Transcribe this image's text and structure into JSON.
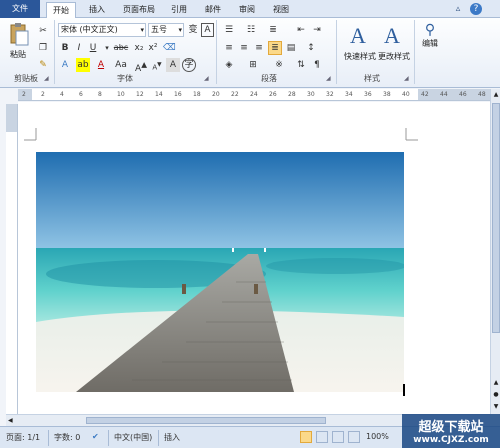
{
  "tabs": {
    "file": "文件",
    "home": "开始",
    "insert": "插入",
    "layout": "页面布局",
    "references": "引用",
    "mailings": "邮件",
    "review": "审阅",
    "view": "视图"
  },
  "clipboard": {
    "paste": "粘贴",
    "group": "剪贴板"
  },
  "font": {
    "name": "宋体 (中文正文)",
    "size": "五号",
    "group": "字体"
  },
  "paragraph": {
    "group": "段落"
  },
  "styles": {
    "quick": "快速样式",
    "change": "更改样式",
    "group": "样式"
  },
  "editing": {
    "label": "编辑"
  },
  "ruler_ticks": [
    "2",
    "2",
    "4",
    "6",
    "8",
    "10",
    "12",
    "14",
    "16",
    "18",
    "20",
    "22",
    "24",
    "26",
    "28",
    "30",
    "32",
    "34",
    "36",
    "38",
    "40",
    "42",
    "44",
    "46",
    "48"
  ],
  "status": {
    "page": "页面: 1/1",
    "words": "字数: 0",
    "language": "中文(中国)",
    "mode": "插入",
    "zoom": "100%"
  },
  "watermark": {
    "title": "超级下载站",
    "url": "www.CJXZ.com"
  },
  "colors": {
    "file_tab": "#2b579a",
    "active_button": "#fbd98a"
  }
}
